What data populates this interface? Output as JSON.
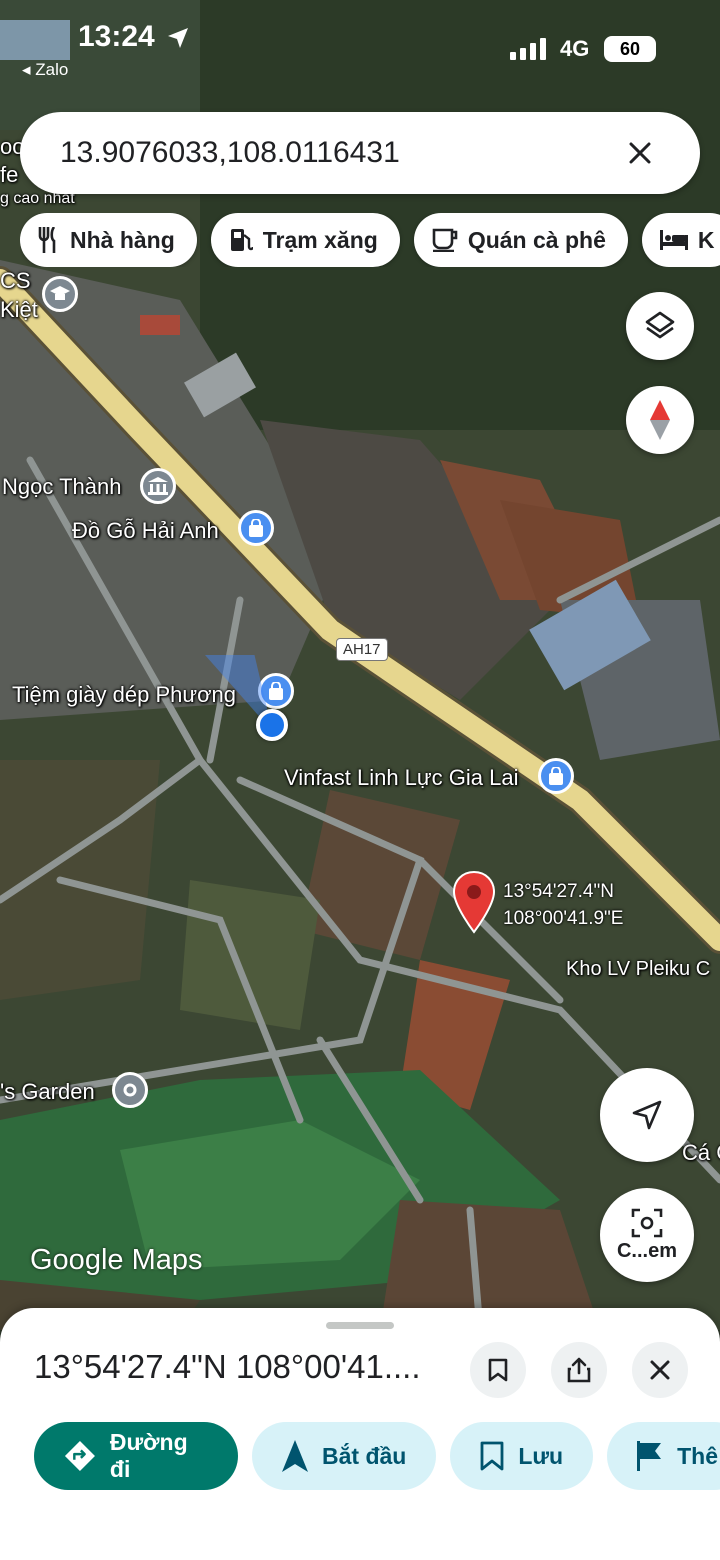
{
  "status_bar": {
    "time": "13:24",
    "back_label": "◂ Zalo",
    "network": "4G",
    "battery": "60"
  },
  "search": {
    "query": "13.9076033,108.0116431"
  },
  "chips": [
    {
      "label": "Nhà hàng",
      "icon": "fork-knife-icon"
    },
    {
      "label": "Trạm xăng",
      "icon": "gas-station-icon"
    },
    {
      "label": "Quán cà phê",
      "icon": "coffee-cup-icon"
    },
    {
      "label": "K",
      "icon": "hotel-bed-icon"
    }
  ],
  "map": {
    "labels": {
      "top_left_1": "oo",
      "top_left_2": "fe",
      "top_left_3": "g cao nhất",
      "school_1": "CS",
      "school_2": "Kiệt",
      "ngoc_thanh": "Ngọc Thành",
      "do_go": "Đồ Gỗ Hải Anh",
      "tiem_giay": "Tiệm giày dép Phương",
      "vinfast": "Vinfast Linh Lực Gia Lai",
      "kho": "Kho LV Pleiku C",
      "garden": "'s Garden",
      "ca": "Cá C"
    },
    "road_shield": "AH17",
    "pin_lat": "13°54'27.4\"N",
    "pin_lng": "108°00'41.9\"E",
    "attribution": "Google Maps"
  },
  "map_buttons": {
    "lens_label": "C...em"
  },
  "sheet": {
    "title": "13°54'27.4\"N 108°00'41....",
    "actions": [
      {
        "label": "Đường đi",
        "icon": "directions-icon"
      },
      {
        "label": "Bắt đầu",
        "icon": "navigation-arrow-icon"
      },
      {
        "label": "Lưu",
        "icon": "bookmark-icon"
      },
      {
        "label": "Thê",
        "icon": "flag-icon"
      }
    ]
  },
  "colors": {
    "primary_action": "#00796b",
    "secondary_action": "#d7f2f8",
    "pin": "#e53935",
    "my_location": "#1a73e8"
  }
}
